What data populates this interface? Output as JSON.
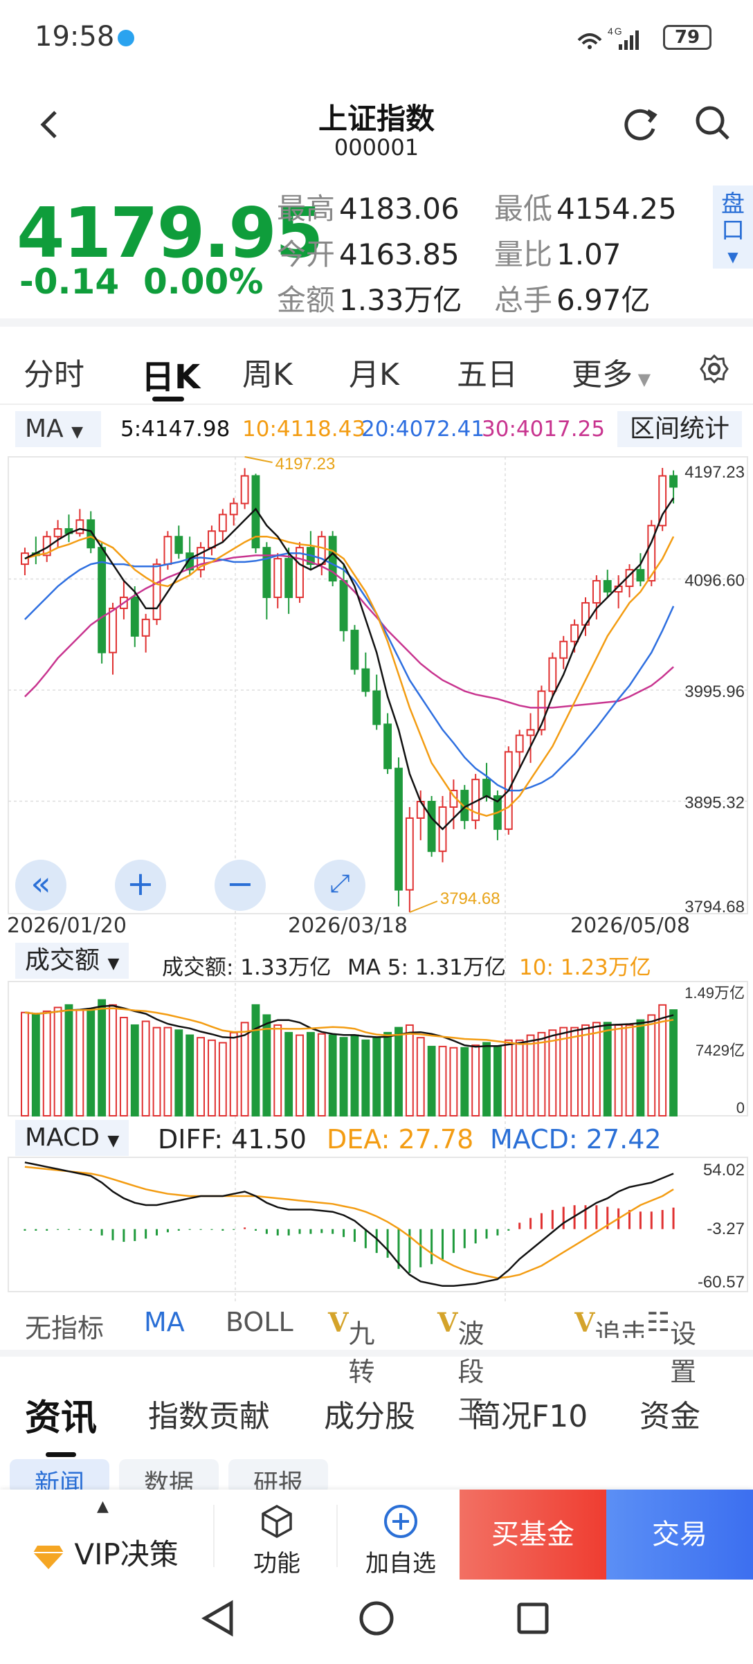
{
  "status": {
    "time": "19:58",
    "signal": "4G",
    "battery": "79"
  },
  "nav": {
    "title": "上证指数",
    "code": "000001"
  },
  "quote": {
    "price": "4179.95",
    "change": "-0.14",
    "change_pct": "0.00%",
    "stats": [
      {
        "k": "最高",
        "v": "4183.06"
      },
      {
        "k": "最低",
        "v": "4154.25"
      },
      {
        "k": "今开",
        "v": "4163.85"
      },
      {
        "k": "量比",
        "v": "1.07"
      },
      {
        "k": "金额",
        "v": "1.33万亿"
      },
      {
        "k": "总手",
        "v": "6.97亿"
      }
    ],
    "pankou": "盘口"
  },
  "tabs": [
    "分时",
    "日K",
    "周K",
    "月K",
    "五日",
    "更多"
  ],
  "ma": {
    "selector": "MA",
    "ma5": "5:4147.98",
    "ma10": "10:4118.43",
    "ma20": "20:4072.41",
    "ma30": "30:4017.25",
    "range_stats": "区间统计"
  },
  "colors": {
    "up": "#e03131",
    "down": "#1f9a3c",
    "ma5": "#111111",
    "ma10": "#f39c12",
    "ma20": "#2e6fe0",
    "ma30": "#c8348f"
  },
  "price_axis": [
    "4197.23",
    "4096.60",
    "3995.96",
    "3895.32",
    "3794.68"
  ],
  "high_label": "4197.23",
  "low_label": "3794.68",
  "dates": [
    "2026/01/20",
    "2026/03/18",
    "2026/05/08"
  ],
  "chart_data": {
    "type": "candlestick",
    "ohlc": [
      [
        4110,
        4125,
        4100,
        4120
      ],
      [
        4120,
        4135,
        4110,
        4118
      ],
      [
        4118,
        4140,
        4112,
        4135
      ],
      [
        4135,
        4150,
        4125,
        4142
      ],
      [
        4142,
        4155,
        4130,
        4138
      ],
      [
        4138,
        4160,
        4135,
        4150
      ],
      [
        4150,
        4158,
        4120,
        4125
      ],
      [
        4125,
        4130,
        4020,
        4030
      ],
      [
        4030,
        4075,
        4010,
        4070
      ],
      [
        4070,
        4095,
        4060,
        4080
      ],
      [
        4080,
        4090,
        4035,
        4045
      ],
      [
        4045,
        4065,
        4030,
        4060
      ],
      [
        4060,
        4115,
        4055,
        4110
      ],
      [
        4110,
        4140,
        4105,
        4135
      ],
      [
        4135,
        4145,
        4115,
        4120
      ],
      [
        4120,
        4135,
        4100,
        4105
      ],
      [
        4105,
        4130,
        4098,
        4125
      ],
      [
        4125,
        4145,
        4118,
        4140
      ],
      [
        4140,
        4160,
        4130,
        4155
      ],
      [
        4155,
        4170,
        4145,
        4165
      ],
      [
        4165,
        4197,
        4160,
        4190
      ],
      [
        4190,
        4192,
        4120,
        4125
      ],
      [
        4125,
        4130,
        4060,
        4080
      ],
      [
        4080,
        4120,
        4070,
        4115
      ],
      [
        4115,
        4125,
        4065,
        4080
      ],
      [
        4080,
        4130,
        4075,
        4125
      ],
      [
        4125,
        4140,
        4105,
        4110
      ],
      [
        4110,
        4140,
        4100,
        4135
      ],
      [
        4135,
        4140,
        4090,
        4095
      ],
      [
        4095,
        4110,
        4040,
        4050
      ],
      [
        4050,
        4055,
        4010,
        4015
      ],
      [
        4015,
        4030,
        3990,
        3995
      ],
      [
        3995,
        4010,
        3960,
        3965
      ],
      [
        3965,
        3975,
        3920,
        3925
      ],
      [
        3925,
        3935,
        3800,
        3815
      ],
      [
        3815,
        3890,
        3794.68,
        3880
      ],
      [
        3880,
        3905,
        3860,
        3895
      ],
      [
        3895,
        3900,
        3845,
        3850
      ],
      [
        3850,
        3900,
        3840,
        3890
      ],
      [
        3890,
        3915,
        3870,
        3905
      ],
      [
        3905,
        3910,
        3870,
        3878
      ],
      [
        3878,
        3920,
        3870,
        3915
      ],
      [
        3915,
        3930,
        3895,
        3900
      ],
      [
        3900,
        3905,
        3860,
        3870
      ],
      [
        3870,
        3945,
        3865,
        3940
      ],
      [
        3940,
        3960,
        3925,
        3955
      ],
      [
        3955,
        3975,
        3930,
        3960
      ],
      [
        3960,
        4000,
        3955,
        3995
      ],
      [
        3995,
        4030,
        3990,
        4025
      ],
      [
        4025,
        4045,
        4015,
        4040
      ],
      [
        4040,
        4060,
        4030,
        4055
      ],
      [
        4055,
        4080,
        4045,
        4075
      ],
      [
        4075,
        4100,
        4060,
        4095
      ],
      [
        4095,
        4105,
        4080,
        4085
      ],
      [
        4085,
        4100,
        4070,
        4090
      ],
      [
        4090,
        4110,
        4080,
        4105
      ],
      [
        4105,
        4120,
        4090,
        4095
      ],
      [
        4095,
        4150,
        4090,
        4145
      ],
      [
        4145,
        4197.23,
        4140,
        4190
      ],
      [
        4190,
        4195,
        4165,
        4180
      ]
    ],
    "ma5_line": [
      4115,
      4120,
      4125,
      4132,
      4138,
      4142,
      4140,
      4125,
      4110,
      4095,
      4085,
      4070,
      4070,
      4085,
      4100,
      4115,
      4120,
      4125,
      4130,
      4140,
      4150,
      4160,
      4145,
      4135,
      4120,
      4110,
      4105,
      4110,
      4120,
      4110,
      4090,
      4060,
      4030,
      3990,
      3960,
      3920,
      3895,
      3880,
      3870,
      3880,
      3890,
      3895,
      3900,
      3895,
      3905,
      3925,
      3945,
      3965,
      3990,
      4010,
      4035,
      4055,
      4070,
      4080,
      4090,
      4100,
      4110,
      4130,
      4155,
      4170
    ],
    "ma10_line": [
      4115,
      4118,
      4120,
      4125,
      4128,
      4132,
      4135,
      4130,
      4125,
      4115,
      4105,
      4098,
      4092,
      4090,
      4095,
      4100,
      4108,
      4112,
      4118,
      4124,
      4130,
      4135,
      4135,
      4133,
      4130,
      4128,
      4127,
      4125,
      4122,
      4115,
      4100,
      4085,
      4065,
      4040,
      4010,
      3980,
      3955,
      3930,
      3915,
      3900,
      3890,
      3885,
      3882,
      3885,
      3890,
      3900,
      3915,
      3930,
      3945,
      3965,
      3985,
      4005,
      4025,
      4045,
      4060,
      4075,
      4085,
      4100,
      4115,
      4135
    ],
    "ma20_line": [
      4060,
      4070,
      4080,
      4090,
      4098,
      4105,
      4110,
      4112,
      4110,
      4110,
      4108,
      4108,
      4108,
      4110,
      4112,
      4115,
      4116,
      4115,
      4114,
      4112,
      4112,
      4113,
      4115,
      4118,
      4120,
      4120,
      4118,
      4115,
      4110,
      4105,
      4095,
      4080,
      4065,
      4045,
      4025,
      4005,
      3990,
      3975,
      3960,
      3948,
      3935,
      3925,
      3918,
      3910,
      3905,
      3905,
      3908,
      3912,
      3918,
      3928,
      3938,
      3950,
      3962,
      3975,
      3988,
      4000,
      4015,
      4030,
      4050,
      4072
    ],
    "ma30_line": [
      3990,
      4000,
      4012,
      4025,
      4035,
      4045,
      4055,
      4062,
      4068,
      4075,
      4082,
      4088,
      4093,
      4098,
      4102,
      4106,
      4110,
      4112,
      4114,
      4116,
      4117,
      4118,
      4118,
      4118,
      4117,
      4115,
      4112,
      4108,
      4103,
      4095,
      4085,
      4073,
      4062,
      4050,
      4040,
      4030,
      4020,
      4012,
      4005,
      4000,
      3995,
      3992,
      3990,
      3988,
      3985,
      3982,
      3980,
      3980,
      3980,
      3981,
      3982,
      3983,
      3984,
      3985,
      3986,
      3990,
      3995,
      4000,
      4008,
      4017
    ]
  },
  "volume": {
    "label": "成交额",
    "amount": "成交额: 1.33万亿",
    "ma5": "MA 5: 1.31万亿",
    "ma10": "10: 1.23万亿",
    "axis": [
      "1.49万亿",
      "7429亿",
      "0"
    ],
    "bars": [
      0.82,
      0.8,
      0.83,
      0.86,
      0.88,
      0.84,
      0.85,
      0.92,
      0.88,
      0.78,
      0.72,
      0.75,
      0.7,
      0.7,
      0.68,
      0.64,
      0.62,
      0.6,
      0.58,
      0.66,
      0.74,
      0.88,
      0.8,
      0.72,
      0.66,
      0.64,
      0.66,
      0.65,
      0.64,
      0.62,
      0.64,
      0.6,
      0.62,
      0.66,
      0.7,
      0.72,
      0.62,
      0.55,
      0.55,
      0.54,
      0.54,
      0.56,
      0.58,
      0.55,
      0.6,
      0.6,
      0.64,
      0.66,
      0.68,
      0.7,
      0.7,
      0.72,
      0.74,
      0.74,
      0.72,
      0.72,
      0.76,
      0.8,
      0.88,
      0.84
    ]
  },
  "macd": {
    "label": "MACD",
    "diff": "DIFF: 41.50",
    "dea": "DEA: 27.78",
    "macd": "MACD: 27.42",
    "axis": [
      "54.02",
      "-3.27",
      "-60.57"
    ],
    "hist": [
      -2,
      -2,
      -2,
      -1,
      -1,
      -1,
      -2,
      -8,
      -14,
      -16,
      -15,
      -12,
      -8,
      -4,
      -2,
      -1,
      -1,
      -1,
      -2,
      -1,
      2,
      -2,
      -6,
      -8,
      -8,
      -6,
      -6,
      -5,
      -6,
      -10,
      -16,
      -24,
      -30,
      -36,
      -50,
      -55,
      -48,
      -44,
      -38,
      -30,
      -24,
      -18,
      -12,
      -8,
      -2,
      8,
      14,
      20,
      24,
      28,
      30,
      30,
      30,
      28,
      26,
      24,
      22,
      22,
      24,
      27
    ],
    "diff_line": [
      52,
      50,
      48,
      46,
      44,
      42,
      40,
      34,
      26,
      20,
      16,
      14,
      14,
      16,
      18,
      20,
      22,
      22,
      22,
      24,
      26,
      22,
      16,
      12,
      10,
      10,
      10,
      9,
      8,
      5,
      0,
      -8,
      -16,
      -26,
      -38,
      -48,
      -54,
      -56,
      -58,
      -58,
      -57,
      -56,
      -54,
      -52,
      -44,
      -34,
      -26,
      -18,
      -10,
      -2,
      4,
      10,
      16,
      20,
      26,
      30,
      32,
      34,
      38,
      42
    ],
    "dea_line": [
      48,
      47,
      46,
      45,
      44,
      43,
      42,
      40,
      37,
      34,
      31,
      28,
      26,
      24,
      23,
      22,
      22,
      22,
      22,
      22,
      22,
      22,
      21,
      20,
      19,
      18,
      17,
      16,
      15,
      13,
      11,
      8,
      4,
      -1,
      -7,
      -14,
      -22,
      -29,
      -35,
      -40,
      -44,
      -47,
      -49,
      -51,
      -50,
      -48,
      -44,
      -40,
      -34,
      -28,
      -22,
      -16,
      -10,
      -4,
      2,
      8,
      14,
      18,
      22,
      28
    ]
  },
  "indicators": [
    "无指标",
    "MA",
    "BOLL",
    "九转",
    "波段王",
    "追击",
    "设置"
  ],
  "info_tabs": [
    "资讯",
    "指数贡献",
    "成分股",
    "简况F10",
    "资金"
  ],
  "sub_tabs": [
    "新闻",
    "数据",
    "研报"
  ],
  "bottom": {
    "vip": "VIP决策",
    "func": "功能",
    "add": "加自选",
    "buy": "买基金",
    "trade": "交易"
  }
}
